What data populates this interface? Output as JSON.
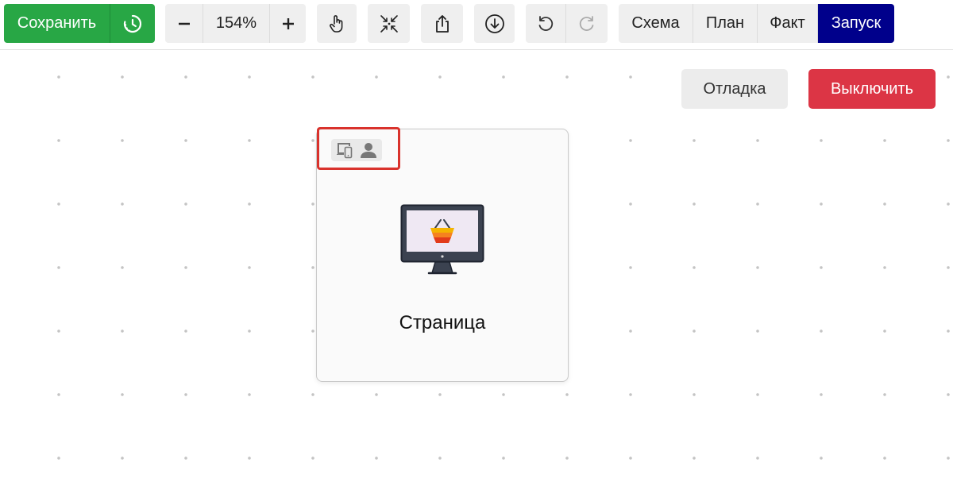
{
  "toolbar": {
    "save_label": "Сохранить",
    "zoom_value": "154%",
    "modes": [
      {
        "label": "Схема"
      },
      {
        "label": "План"
      },
      {
        "label": "Факт"
      },
      {
        "label": "Запуск"
      }
    ],
    "active_mode": "Запуск"
  },
  "controls": {
    "debug_label": "Отладка",
    "off_label": "Выключить"
  },
  "node": {
    "label": "Страница",
    "icon": "monitor-basket-icon",
    "badges": [
      "devices-icon",
      "user-icon"
    ]
  },
  "colors": {
    "save": "#28a745",
    "active_mode": "#00008b",
    "off": "#dc3545",
    "highlight": "#d9322c"
  }
}
